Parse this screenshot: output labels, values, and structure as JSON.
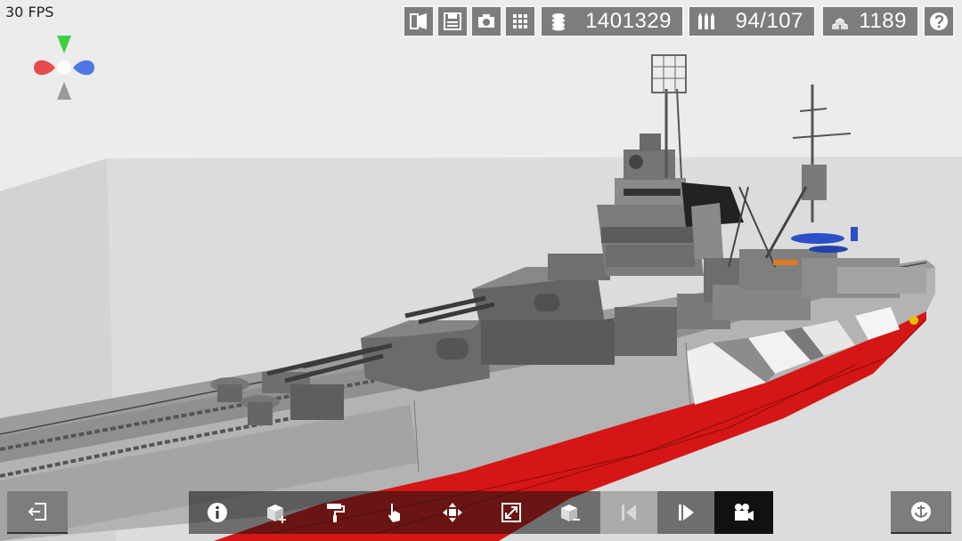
{
  "hud": {
    "fps": "30 FPS"
  },
  "stats": {
    "credits": "1401329",
    "ammo": "94/107",
    "parts": "1189"
  },
  "icons": {
    "view_mode": "book-open-icon",
    "save": "save-icon",
    "screenshot": "camera-icon",
    "grid": "grid-icon",
    "credits": "coins-icon",
    "ammo": "bullets-icon",
    "parts": "cubes-icon",
    "help": "question-icon",
    "exit": "exit-icon",
    "info": "info-icon",
    "add_part": "add-block-icon",
    "paint": "paint-roller-icon",
    "select": "hand-pointer-icon",
    "move": "move-arrows-icon",
    "scale": "resize-icon",
    "remove_part": "remove-block-icon",
    "previous": "step-back-icon",
    "next": "step-forward-icon",
    "camera": "video-camera-icon",
    "anchor": "anchor-icon"
  },
  "colors": {
    "hud_button": "#7d7d7d",
    "hull_red": "#d51616",
    "hull_gray": "#a9a9a9",
    "deck": "#8e8e8e",
    "plane_blue": "#2b4fc4",
    "gizmo_x": "#e84b4b",
    "gizmo_y": "#3fcf3f",
    "gizmo_z": "#4d79e6"
  }
}
